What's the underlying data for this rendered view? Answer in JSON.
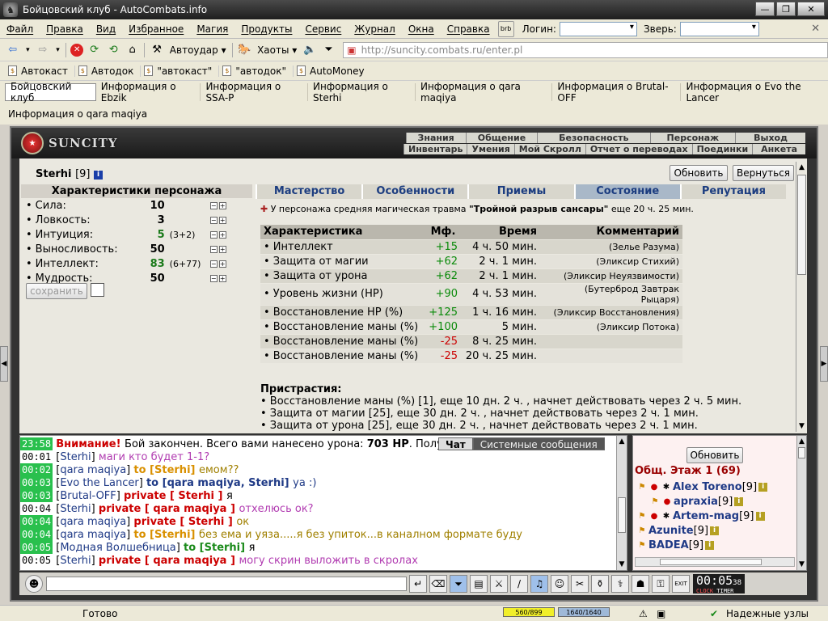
{
  "window": {
    "title": "Бойцовский клуб - AutoCombats.info"
  },
  "menu": [
    "Файл",
    "Правка",
    "Вид",
    "Избранное",
    "Магия",
    "Продукты",
    "Сервис",
    "Журнал",
    "Окна",
    "Справка"
  ],
  "login": {
    "label": "Логин:",
    "beast_label": "Зверь:"
  },
  "toolbar": {
    "autoudar": "Автоудар",
    "chaos": "Хаоты",
    "address": "http://suncity.combats.ru/enter.pl"
  },
  "favorites": [
    "Автокаст",
    "Автодок",
    "\"автокаст\"",
    "\"автодок\"",
    "AutoMoney"
  ],
  "tabs": [
    "Бойцовский клуб",
    "Информация о Ebzik",
    "Информация о SSA-P",
    "Информация о Sterhi",
    "Информация о qara maqiya",
    "Информация о Brutal-OFF",
    "Информация о Evo the Lancer"
  ],
  "tab2": "Информация о qara maqiya",
  "logo": {
    "wordmark": "SUNCITY"
  },
  "nav": {
    "row1": [
      "Знания",
      "Общение",
      "Безопасность",
      "Персонаж",
      "Выход"
    ],
    "row2": [
      "Инвентарь",
      "Умения",
      "Мой Скролл",
      "Отчет о переводах",
      "Поединки",
      "Анкета"
    ]
  },
  "character": {
    "name": "Sterhi",
    "level": "[9]",
    "info": "i"
  },
  "buttons": {
    "refresh": "Обновить",
    "back": "Вернуться",
    "save": "сохранить"
  },
  "stats": {
    "title": "Характеристики персонажа",
    "rows": [
      {
        "name": "Сила:",
        "value": "10",
        "bonus": ""
      },
      {
        "name": "Ловкость:",
        "value": "3",
        "bonus": ""
      },
      {
        "name": "Интуиция:",
        "value": "5",
        "bonus": "(3+2)"
      },
      {
        "name": "Выносливость:",
        "value": "50",
        "bonus": ""
      },
      {
        "name": "Интеллект:",
        "value": "83",
        "bonus": "(6+77)"
      },
      {
        "name": "Мудрость:",
        "value": "50",
        "bonus": ""
      }
    ],
    "green_rows": [
      2,
      4
    ]
  },
  "state_tabs": [
    "Мастерство",
    "Особенности",
    "Приемы",
    "Состояние",
    "Репутация"
  ],
  "state_active": 3,
  "magic": {
    "pre": "У персонажа средняя магическая травма ",
    "name": "\"Тройной разрыв сансары\"",
    "post": " еще 20 ч. 25 мин."
  },
  "effects": {
    "headers": [
      "Характеристика",
      "Мф.",
      "Время",
      "Комментарий"
    ],
    "rows": [
      {
        "c": "• Интеллект",
        "m": "+15",
        "t": "4 ч. 50 мин.",
        "k": "(Зелье Разума)"
      },
      {
        "c": "• Защита от магии",
        "m": "+62",
        "t": "2 ч. 1 мин.",
        "k": "(Эликсир Стихий)"
      },
      {
        "c": "• Защита от урона",
        "m": "+62",
        "t": "2 ч. 1 мин.",
        "k": "(Эликсир Неуязвимости)"
      },
      {
        "c": "• Уровень жизни (HP)",
        "m": "+90",
        "t": "4 ч. 53 мин.",
        "k": "(Бутерброд Завтрак Рыцаря)"
      },
      {
        "c": "• Восстановление HP (%)",
        "m": "+125",
        "t": "1 ч. 16 мин.",
        "k": "(Эликсир Восстановления)"
      },
      {
        "c": "• Восстановление маны (%)",
        "m": "+100",
        "t": "5 мин.",
        "k": "(Эликсир Потока)"
      },
      {
        "c": "• Восстановление маны (%)",
        "m": "-25",
        "t": "8 ч. 25 мин.",
        "k": ""
      },
      {
        "c": "• Восстановление маны (%)",
        "m": "-25",
        "t": "20 ч. 25 мин.",
        "k": ""
      }
    ]
  },
  "addictions": {
    "title": "Пристрастия:",
    "lines": [
      "• Восстановление маны (%) [1], еще 10 дн. 2 ч. , начнет действовать через 2 ч. 5 мин.",
      "• Защита от магии [25], еще 30 дн. 2 ч. , начнет действовать через 2 ч. 1 мин.",
      "• Защита от урона [25], еще 30 дн. 2 ч. , начнет действовать через 2 ч. 1 мин."
    ]
  },
  "chat_tabs": [
    "Чат",
    "Системные сообщения"
  ],
  "chat": [
    {
      "t": "23:58",
      "hl": true,
      "parts": [
        {
          "c": "cred",
          "s": "Внимание! "
        },
        {
          "c": "",
          "s": "Бой закончен. Всего вами нанесено урона: "
        },
        {
          "c": "b",
          "s": "703 HP"
        },
        {
          "c": "",
          "s": ". Полу"
        }
      ]
    },
    {
      "t": "00:01",
      "hl": false,
      "parts": [
        {
          "c": "",
          "s": "["
        },
        {
          "c": "nm",
          "s": "Sterhi"
        },
        {
          "c": "",
          "s": "] "
        },
        {
          "c": "mag",
          "s": "маги кто будет 1-1?"
        }
      ]
    },
    {
      "t": "00:02",
      "hl": true,
      "parts": [
        {
          "c": "",
          "s": "["
        },
        {
          "c": "nm",
          "s": "qara maqiya"
        },
        {
          "c": "",
          "s": "] "
        },
        {
          "c": "tgt",
          "s": "to [Sterhi] "
        },
        {
          "c": "olive",
          "s": "емом??"
        }
      ]
    },
    {
      "t": "00:03",
      "hl": true,
      "parts": [
        {
          "c": "",
          "s": "["
        },
        {
          "c": "nm",
          "s": "Evo the Lancer"
        },
        {
          "c": "",
          "s": "] "
        },
        {
          "c": "nmb",
          "s": "to [qara maqiya, Sterhi] "
        },
        {
          "c": "nm",
          "s": "ya :)"
        }
      ]
    },
    {
      "t": "00:03",
      "hl": true,
      "parts": [
        {
          "c": "",
          "s": "["
        },
        {
          "c": "nm",
          "s": "Brutal-OFF"
        },
        {
          "c": "",
          "s": "] "
        },
        {
          "c": "cred",
          "s": "private [ Sterhi ] "
        },
        {
          "c": "",
          "s": "я"
        }
      ]
    },
    {
      "t": "00:04",
      "hl": false,
      "parts": [
        {
          "c": "",
          "s": "["
        },
        {
          "c": "nm",
          "s": "Sterhi"
        },
        {
          "c": "",
          "s": "] "
        },
        {
          "c": "cred",
          "s": "private [ qara maqiya ] "
        },
        {
          "c": "mag",
          "s": "отхелюсь ок?"
        }
      ]
    },
    {
      "t": "00:04",
      "hl": true,
      "parts": [
        {
          "c": "",
          "s": "["
        },
        {
          "c": "nm",
          "s": "qara maqiya"
        },
        {
          "c": "",
          "s": "] "
        },
        {
          "c": "cred",
          "s": "private [ Sterhi ] "
        },
        {
          "c": "olive",
          "s": "ок"
        }
      ]
    },
    {
      "t": "00:04",
      "hl": true,
      "parts": [
        {
          "c": "",
          "s": "["
        },
        {
          "c": "nm",
          "s": "qara maqiya"
        },
        {
          "c": "",
          "s": "] "
        },
        {
          "c": "tgt",
          "s": "to [Sterhi] "
        },
        {
          "c": "olive",
          "s": "без ема и уяза.....я без упиток...в каналном формате буду"
        }
      ]
    },
    {
      "t": "00:05",
      "hl": true,
      "parts": [
        {
          "c": "",
          "s": "["
        },
        {
          "c": "nm",
          "s": "Модная Волшебница"
        },
        {
          "c": "",
          "s": "] "
        },
        {
          "c": "tgtg",
          "s": "to [Sterhi] "
        },
        {
          "c": "",
          "s": "я"
        }
      ]
    },
    {
      "t": "00:05",
      "hl": false,
      "parts": [
        {
          "c": "",
          "s": "["
        },
        {
          "c": "nm",
          "s": "Sterhi"
        },
        {
          "c": "",
          "s": "] "
        },
        {
          "c": "cred",
          "s": "private [ qara maqiya ] "
        },
        {
          "c": "mag",
          "s": "могу скрин выложить в скролах"
        }
      ]
    }
  ],
  "online": {
    "refresh": "Обновить",
    "title": "Общ. Этаж 1 (69)",
    "users": [
      {
        "name": "Alex Toreno",
        "level": "[9]"
      },
      {
        "name": "apraxia",
        "level": "[9]"
      },
      {
        "name": "Artem-mag",
        "level": "[9]"
      },
      {
        "name": "Azunite",
        "level": "[9]"
      },
      {
        "name": "BADEA",
        "level": "[9]"
      }
    ]
  },
  "clock": {
    "time": "00:05",
    "sec": "38",
    "l1": "CLOCK",
    "l2": "TIMER"
  },
  "status": {
    "ready": "Готово",
    "hp": "560/899",
    "mana": "1640/1640",
    "conn": "Надежные узлы"
  },
  "colors": {
    "hp": "#f1ef2a",
    "mana": "#9fb9d8",
    "chat_time_bg": "#29c04d"
  }
}
